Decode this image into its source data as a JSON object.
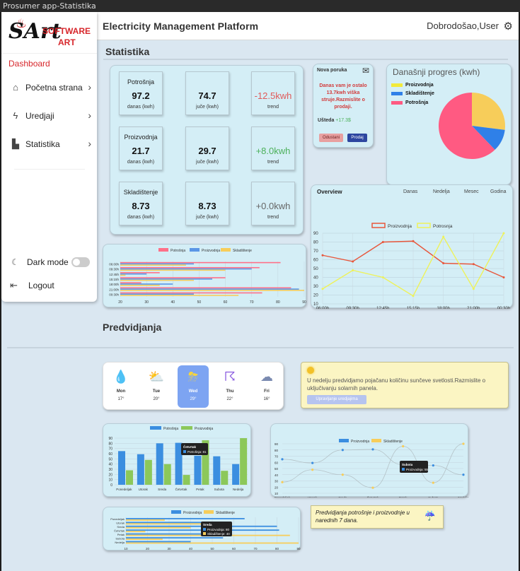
{
  "window": {
    "title": "Prosumer app-Statistika"
  },
  "header": {
    "platform": "Electricity Management Platform",
    "welcome": "Dobrodošao,User"
  },
  "sidebar": {
    "logo": {
      "software": "SOFTWARE",
      "art": "ART",
      "s": "SArt"
    },
    "dashboard": "Dashboard",
    "items": [
      {
        "label": "Početna strana"
      },
      {
        "label": "Uredjaji"
      },
      {
        "label": "Statistika"
      }
    ],
    "dark_mode": "Dark mode",
    "logout": "Logout"
  },
  "statistika": {
    "title": "Statistika",
    "rows": [
      {
        "label": "Potrošnja",
        "today": "97.2",
        "today_sub": "danas (kwh)",
        "yesterday": "74.7",
        "yesterday_sub": "juče (kwh)",
        "trend": "-12.5kwh",
        "trend_sub": "trend"
      },
      {
        "label": "Proizvodnja",
        "today": "21.7",
        "today_sub": "danas (kwh)",
        "yesterday": "29.7",
        "yesterday_sub": "juče (kwh)",
        "trend": "+8.0kwh",
        "trend_sub": "trend"
      },
      {
        "label": "Skladištenje",
        "today": "8.73",
        "today_sub": "danas (kwh)",
        "yesterday": "8.73",
        "yesterday_sub": "juče (kwh)",
        "trend": "+0.0kwh",
        "trend_sub": "trend"
      }
    ]
  },
  "message": {
    "head": "Nova poruka",
    "body": "Danas vam je ostalo 13.7kwh viška struje.Razmislite o prodaji.",
    "savings_label": "Ušteda",
    "savings_value": "+17.3$",
    "decline": "Odustani",
    "sell": "Prodaj"
  },
  "progress": {
    "title": "Današnji progres (kwh)",
    "legend": [
      {
        "label": "Proizvodnja",
        "color": "#f2ea3c"
      },
      {
        "label": "Skladištenje",
        "color": "#2f80e8"
      },
      {
        "label": "Potrošnja",
        "color": "#ff5a82"
      }
    ]
  },
  "overview": {
    "title": "Overview",
    "tabs": [
      "Danas",
      "Nedelja",
      "Mesec",
      "Godina"
    ]
  },
  "predvidjanja": {
    "title": "Predvidjanja"
  },
  "forecast": [
    {
      "day": "Mon",
      "temp": "17°",
      "icon": "rain-icon"
    },
    {
      "day": "Tue",
      "temp": "20°",
      "icon": "cloud-rain-icon"
    },
    {
      "day": "Wed",
      "temp": "29°",
      "icon": "sun-cloud-storm-icon",
      "active": true
    },
    {
      "day": "Thu",
      "temp": "22°",
      "icon": "storm-icon"
    },
    {
      "day": "Fri",
      "temp": "16°",
      "icon": "night-snow-icon"
    }
  ],
  "tip": {
    "text": "U nedelju predvidjamo pojačanu količinu sunčeve svetlosti.Razmislite o uključivanju solarnih panela.",
    "button": "Upravljanje uredjajima"
  },
  "pred_note": "Predvidjanja potrošnje i proizvodnje u narednih 7 dana.",
  "chart_data": [
    {
      "type": "pie",
      "id": "today-progress",
      "labels": [
        "Proizvodnja",
        "Skladištenje",
        "Potrošnja"
      ],
      "values": [
        21.7,
        8.73,
        50
      ],
      "colors": [
        "#f7cd5a",
        "#2f80e8",
        "#ff5a82"
      ]
    },
    {
      "type": "line",
      "id": "overview",
      "categories": [
        "06:00h",
        "09:30h",
        "12:45h",
        "15:15h",
        "18:00h",
        "21:00h",
        "00:30h"
      ],
      "series": [
        {
          "name": "Proizvodnja",
          "color": "#e8573c",
          "values": [
            65,
            58,
            80,
            81,
            56,
            55,
            40
          ]
        },
        {
          "name": "Potrosnja",
          "color": "#eef25a",
          "values": [
            27,
            48,
            40,
            19,
            86,
            27,
            90
          ]
        }
      ],
      "ylim": [
        10,
        90
      ],
      "yticks": [
        10,
        20,
        30,
        40,
        50,
        60,
        70,
        80,
        90
      ],
      "xtick_labels": [
        "06:00h",
        "09:30h",
        "12:45h",
        "15:15h",
        "18:00h",
        "21:00h",
        "00:30h"
      ]
    },
    {
      "type": "bar",
      "id": "hourly-horizontal",
      "orientation": "horizontal",
      "categories": [
        "06:00h",
        "09:30h",
        "12:45h",
        "15:15h",
        "18:00h",
        "21:00h",
        "00:30h"
      ],
      "series": [
        {
          "name": "Potrošnja",
          "color": "#ff7088",
          "values": [
            81,
            73,
            35,
            60,
            28,
            85,
            74
          ]
        },
        {
          "name": "Proizvodnja",
          "color": "#5a96e6",
          "values": [
            48,
            70,
            30,
            55,
            40,
            88,
            48
          ]
        },
        {
          "name": "Skladištenje",
          "color": "#f7cd5a",
          "values": [
            45,
            60,
            22,
            48,
            35,
            90,
            65
          ]
        }
      ],
      "xlim": [
        20,
        90
      ],
      "xticks": [
        20,
        30,
        40,
        50,
        60,
        70,
        80,
        90
      ]
    },
    {
      "type": "bar",
      "id": "weekly-bars",
      "categories": [
        "Ponedeljak",
        "Utorak",
        "Sreda",
        "Četvrtak",
        "Petak",
        "Subota",
        "Nedelja"
      ],
      "series": [
        {
          "name": "Potrošnja",
          "color": "#3b8ee0",
          "values": [
            65,
            59,
            80,
            81,
            56,
            55,
            40
          ]
        },
        {
          "name": "Proizvodnja",
          "color": "#8cc85a",
          "values": [
            28,
            48,
            40,
            19,
            86,
            27,
            90
          ]
        }
      ],
      "ylim": [
        0,
        90
      ],
      "yticks": [
        0,
        10,
        20,
        30,
        40,
        50,
        60,
        70,
        80,
        90
      ],
      "tooltip": {
        "title": "Četvrtak",
        "line": "Potrošnja: 81"
      }
    },
    {
      "type": "line",
      "id": "weekly-smooth",
      "categories": [
        "Ponedeljak",
        "Utorak",
        "Sreda",
        "Četvrtak",
        "Petak",
        "Subota",
        "Nedelja"
      ],
      "series": [
        {
          "name": "Proizvodnja",
          "color": "#3b8ee0",
          "values": [
            65,
            59,
            80,
            81,
            56,
            55,
            40
          ]
        },
        {
          "name": "Skladištenje",
          "color": "#f7cd5a",
          "values": [
            28,
            48,
            40,
            19,
            86,
            27,
            90
          ]
        }
      ],
      "ylim": [
        10,
        90
      ],
      "yticks": [
        10,
        20,
        30,
        40,
        50,
        60,
        70,
        80,
        90
      ],
      "tooltip": {
        "title": "Subota",
        "line": "Proizvodnja: 55"
      }
    },
    {
      "type": "bar",
      "id": "weekly-horizontal",
      "orientation": "horizontal",
      "categories": [
        "Ponedeljak",
        "Utorak",
        "Sreda",
        "Četvrtak",
        "Petak",
        "Subota",
        "Nedelja"
      ],
      "series": [
        {
          "name": "Proizvodnja",
          "color": "#3b8ee0",
          "values": [
            65,
            59,
            80,
            81,
            56,
            55,
            40
          ]
        },
        {
          "name": "Skladištenje",
          "color": "#f7cd5a",
          "values": [
            28,
            48,
            40,
            19,
            86,
            27,
            90
          ]
        }
      ],
      "xlim": [
        10,
        90
      ],
      "xticks": [
        10,
        20,
        30,
        40,
        50,
        60,
        70,
        80,
        90
      ],
      "tooltip": {
        "title": "Sreda",
        "lines": [
          "Proizvodnja: 80",
          "Skladištenje: 40"
        ]
      }
    }
  ]
}
